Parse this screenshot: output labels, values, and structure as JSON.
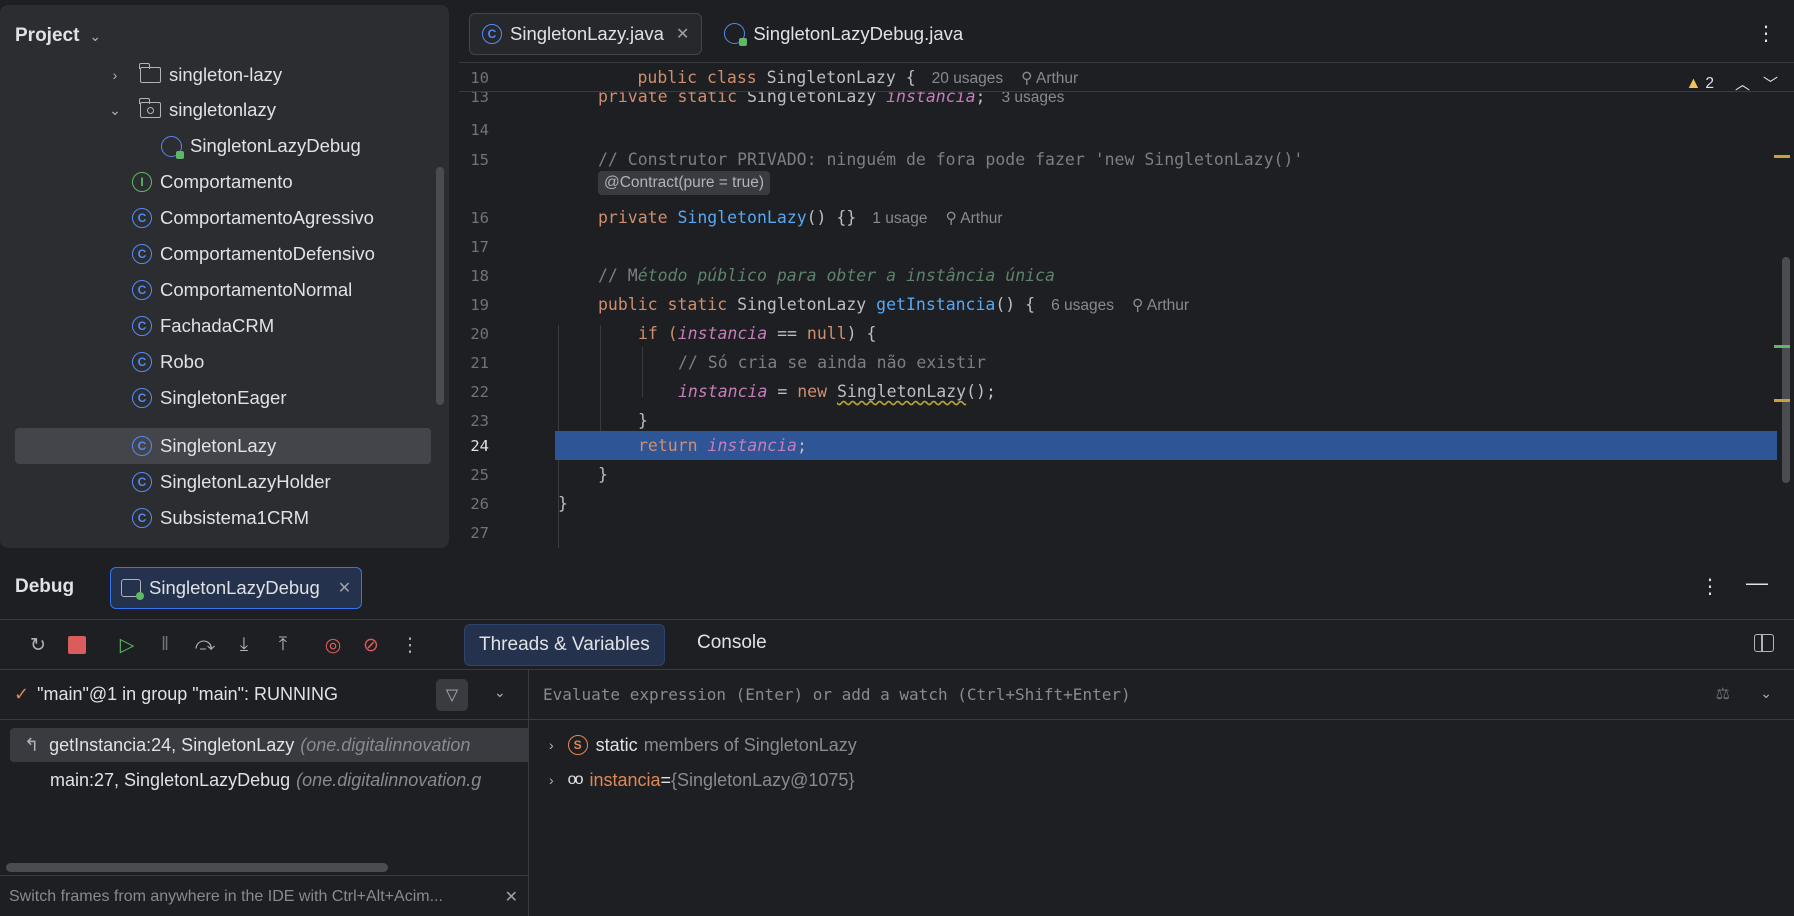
{
  "project": {
    "title": "Project",
    "items": [
      {
        "label": "singleton-lazy",
        "type": "folder",
        "arrow": "›"
      },
      {
        "label": "singletonlazy",
        "type": "package",
        "arrow": "⌄"
      },
      {
        "label": "SingletonLazyDebug",
        "type": "debugclass"
      },
      {
        "label": "Comportamento",
        "type": "interface"
      },
      {
        "label": "ComportamentoAgressivo",
        "type": "class"
      },
      {
        "label": "ComportamentoDefensivo",
        "type": "class"
      },
      {
        "label": "ComportamentoNormal",
        "type": "class"
      },
      {
        "label": "FachadaCRM",
        "type": "class"
      },
      {
        "label": "Robo",
        "type": "class"
      },
      {
        "label": "SingletonEager",
        "type": "class"
      },
      {
        "label": "SingletonLazy",
        "type": "class",
        "selected": true
      },
      {
        "label": "SingletonLazyHolder",
        "type": "class"
      },
      {
        "label": "Subsistema1CRM",
        "type": "class"
      }
    ]
  },
  "editor": {
    "tabs": [
      {
        "label": "SingletonLazy.java",
        "active": true
      },
      {
        "label": "SingletonLazyDebug.java",
        "active": false
      }
    ],
    "warnings": "2",
    "sticky": {
      "ln": "10",
      "kw": "public class ",
      "name": "SingletonLazy {",
      "usages": "20 usages",
      "author": "Arthur"
    },
    "lines": {
      "l13": {
        "ln": "13",
        "a": "private static ",
        "b": "SingletonLazy ",
        "c": "instancia",
        "d": ";",
        "hint": "3 usages"
      },
      "l14": {
        "ln": "14"
      },
      "l15": {
        "ln": "15",
        "text": "// Construtor PRIVADO: ninguém de fora pode fazer 'new SingletonLazy()'"
      },
      "contract": "@Contract(pure = true)",
      "l16": {
        "ln": "16",
        "a": "private ",
        "b": "SingletonLazy",
        "c": "() {}",
        "hint": "1 usage",
        "author": "Arthur"
      },
      "l17": {
        "ln": "17"
      },
      "l18": {
        "ln": "18",
        "a": "// M",
        "b": "étodo público para obter a instância única"
      },
      "l19": {
        "ln": "19",
        "a": "public static ",
        "b": "SingletonLazy ",
        "c": "getInstancia",
        "d": "() {",
        "hint": "6 usages",
        "author": "Arthur"
      },
      "l20": {
        "ln": "20",
        "a": "if (",
        "b": "instancia",
        "c": " == ",
        "d": "null",
        "e": ") {"
      },
      "l21": {
        "ln": "21",
        "text": "// Só cria se ainda não existir"
      },
      "l22": {
        "ln": "22",
        "a": "instancia",
        "b": " = ",
        "c": "new ",
        "d": "SingletonLazy",
        "e": "();"
      },
      "l23": {
        "ln": "23",
        "text": "}"
      },
      "l24": {
        "ln": "24",
        "a": "return ",
        "b": "instancia",
        "c": ";"
      },
      "l25": {
        "ln": "25",
        "text": "}"
      },
      "l26": {
        "ln": "26",
        "text": "}"
      },
      "l27": {
        "ln": "27"
      }
    }
  },
  "debug": {
    "title": "Debug",
    "session_tab": "SingletonLazyDebug",
    "tabs": {
      "threads": "Threads & Variables",
      "console": "Console"
    },
    "thread": "\"main\"@1 in group \"main\": RUNNING",
    "frames": [
      {
        "method": "getInstancia:24, SingletonLazy",
        "pkg": "(one.digitalinnovation"
      },
      {
        "method": "main:27, SingletonLazyDebug",
        "pkg": "(one.digitalinnovation.g"
      }
    ],
    "hint": "Switch frames from anywhere in the IDE with Ctrl+Alt+Acim...",
    "eval_placeholder": "Evaluate expression (Enter) or add a watch (Ctrl+Shift+Enter)",
    "variables": [
      {
        "name": "static",
        "rest": "members of SingletonLazy"
      },
      {
        "name": "instancia",
        "eq": " = ",
        "rest": "{SingletonLazy@1075}"
      }
    ]
  },
  "colors": {
    "accent": "#3574f0",
    "selection": "#214283",
    "keyword": "#cf8e6d",
    "field": "#c77dbb"
  }
}
